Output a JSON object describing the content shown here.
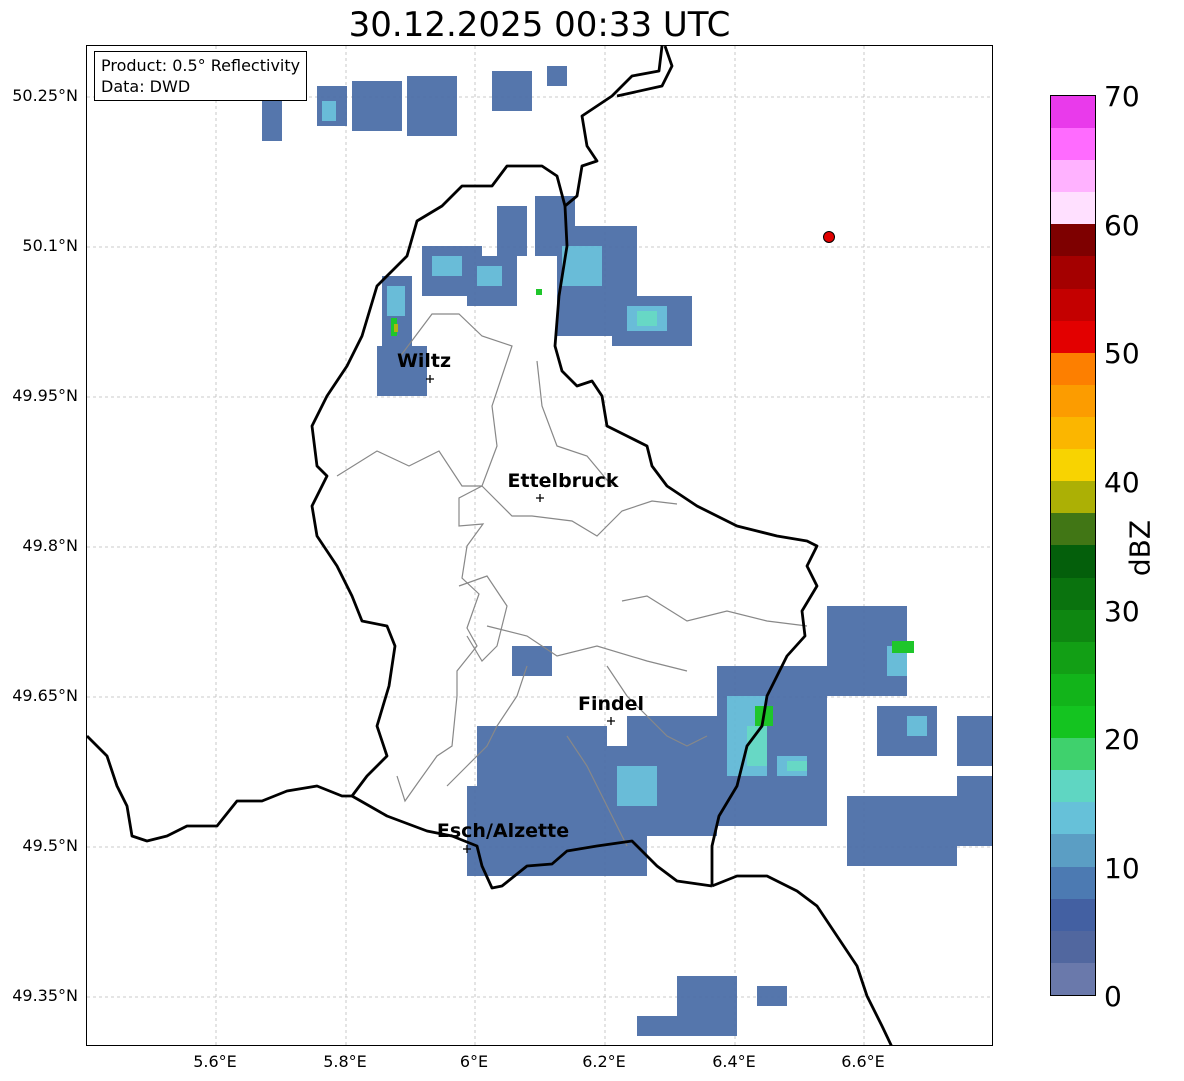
{
  "title": "30.12.2025 00:33 UTC",
  "info": {
    "product": "Product: 0.5° Reflectivity",
    "source": "Data: DWD"
  },
  "axes": {
    "lat_labels": [
      "50.25°N",
      "50.1°N",
      "49.95°N",
      "49.8°N",
      "49.65°N",
      "49.5°N",
      "49.35°N"
    ],
    "lon_labels": [
      "5.6°E",
      "5.8°E",
      "6°E",
      "6.2°E",
      "6.4°E",
      "6.6°E"
    ]
  },
  "cities": [
    {
      "name": "Wiltz"
    },
    {
      "name": "Ettelbruck"
    },
    {
      "name": "Findel"
    },
    {
      "name": "Esch/Alzette"
    }
  ],
  "colorbar": {
    "label": "dBZ",
    "ticks": [
      "0",
      "10",
      "20",
      "30",
      "40",
      "50",
      "60",
      "70"
    ],
    "colors": [
      "#6a79ab",
      "#51679f",
      "#4360a2",
      "#4c7ab2",
      "#5b9ec4",
      "#66c1d9",
      "#5fd6c2",
      "#3fd16d",
      "#14c420",
      "#12b41a",
      "#129f15",
      "#0e8711",
      "#0a730e",
      "#045f0b",
      "#417615",
      "#acb005",
      "#f8d301",
      "#fbb600",
      "#fc9c00",
      "#fd7f00",
      "#e30000",
      "#c40000",
      "#a40000",
      "#7e0000",
      "#ffe0ff",
      "#ffb2ff",
      "#ff6bff",
      "#e93aeb"
    ]
  },
  "radar_marker": {
    "color": "#e00000"
  }
}
